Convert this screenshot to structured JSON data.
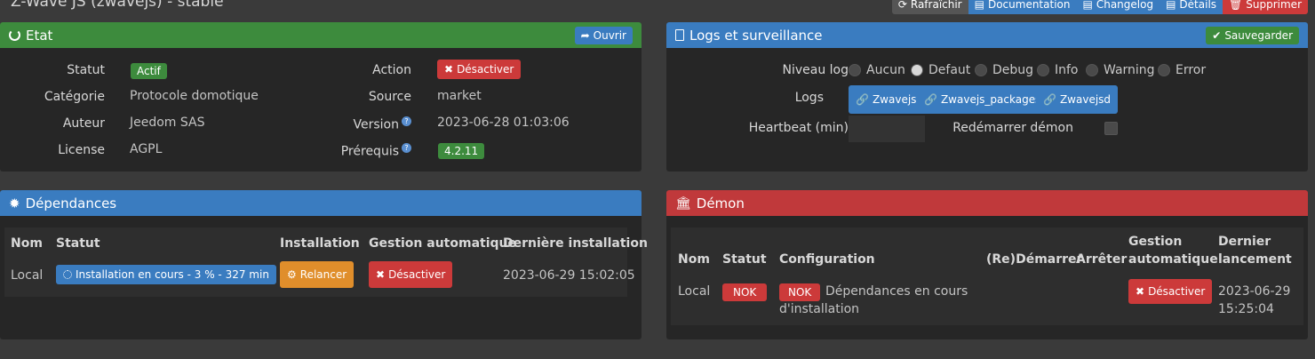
{
  "page": {
    "title": "Z-Wave JS (zwavejs) - stable"
  },
  "toolbar": {
    "refresh": "Rafraîchir",
    "documentation": "Documentation",
    "changelog": "Changelog",
    "details": "Détails",
    "delete": "Supprimer"
  },
  "etat": {
    "title": "Etat",
    "open_button": "Ouvrir",
    "statut_label": "Statut",
    "statut_value": "Actif",
    "categorie_label": "Catégorie",
    "categorie_value": "Protocole domotique",
    "auteur_label": "Auteur",
    "auteur_value": "Jeedom SAS",
    "license_label": "License",
    "license_value": "AGPL",
    "action_label": "Action",
    "action_button": "Désactiver",
    "source_label": "Source",
    "source_value": "market",
    "version_label": "Version",
    "version_value": "2023-06-28 01:03:06",
    "prerequis_label": "Prérequis",
    "prerequis_value": "4.2.11"
  },
  "logs": {
    "title": "Logs et surveillance",
    "save_button": "Sauvegarder",
    "niveau_label": "Niveau log",
    "levels": [
      "Aucun",
      "Defaut",
      "Debug",
      "Info",
      "Warning",
      "Error"
    ],
    "selected_level": "Defaut",
    "logs_label": "Logs",
    "log_buttons": [
      "Zwavejs",
      "Zwavejs_packages",
      "Zwavejsd"
    ],
    "heartbeat_label": "Heartbeat (min)",
    "heartbeat_value": "",
    "restart_label": "Redémarrer démon"
  },
  "dependances": {
    "title": "Dépendances",
    "headers": [
      "Nom",
      "Statut",
      "Installation",
      "Gestion automatique",
      "Dernière installation"
    ],
    "row": {
      "nom": "Local",
      "statut": "Installation en cours - 3 % - 327 min",
      "installation": "Relancer",
      "gestion": "Désactiver",
      "derniere": "2023-06-29 15:02:05"
    }
  },
  "demon": {
    "title": "Démon",
    "headers": {
      "nom": "Nom",
      "statut": "Statut",
      "configuration": "Configuration",
      "redemarrer": "(Re)Démarrer",
      "arreter": "Arrêter",
      "gestion_1": "Gestion",
      "gestion_2": "automatique",
      "dernier_1": "Dernier",
      "dernier_2": "lancement"
    },
    "row": {
      "nom": "Local",
      "statut": "NOK",
      "config_badge": "NOK",
      "config_text_1": "Dépendances en cours",
      "config_text_2": "d'installation",
      "gestion": "Désactiver",
      "dernier_1": "2023-06-29",
      "dernier_2": "15:25:04"
    }
  },
  "colors": {
    "green": "#3d8b3d",
    "blue": "#3a7cc0",
    "red": "#c0393b",
    "orange": "#e08e2b"
  }
}
